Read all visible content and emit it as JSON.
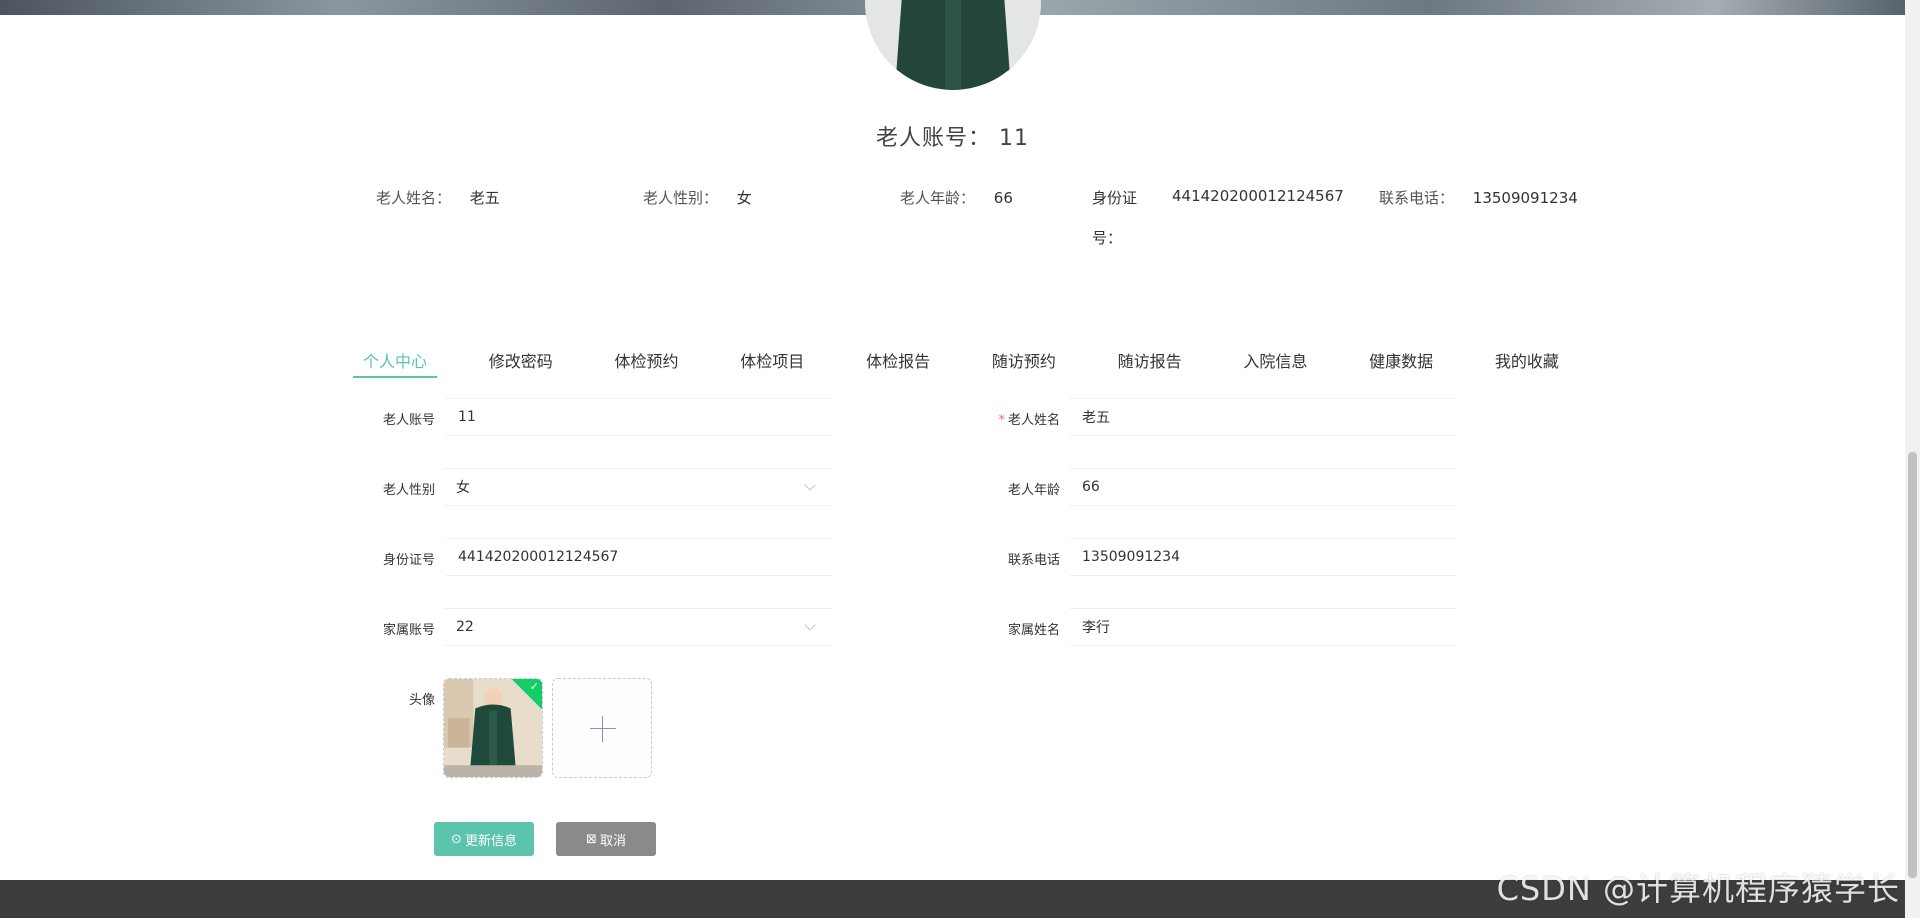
{
  "profile": {
    "account_label": "老人账号：",
    "account_value": "11",
    "info": [
      {
        "label": "老人姓名：",
        "value": "老五"
      },
      {
        "label": "老人性别：",
        "value": "女"
      },
      {
        "label": "老人年龄：",
        "value": "66"
      },
      {
        "label_line1": "身份证",
        "label_line2": "号：",
        "value": "441420200012124567"
      },
      {
        "label": "联系电话：",
        "value": "13509091234"
      }
    ]
  },
  "tabs": [
    {
      "label": "个人中心",
      "active": true
    },
    {
      "label": "修改密码"
    },
    {
      "label": "体检预约"
    },
    {
      "label": "体检项目"
    },
    {
      "label": "体检报告"
    },
    {
      "label": "随访预约"
    },
    {
      "label": "随访报告"
    },
    {
      "label": "入院信息"
    },
    {
      "label": "健康数据"
    },
    {
      "label": "我的收藏"
    }
  ],
  "form": {
    "account_label": "老人账号",
    "account_value": "11",
    "name_label": "老人姓名",
    "name_value": "老五",
    "name_required": "*",
    "gender_label": "老人性别",
    "gender_value": "女",
    "age_label": "老人年龄",
    "age_value": "66",
    "idcard_label": "身份证号",
    "idcard_value": "441420200012124567",
    "phone_label": "联系电话",
    "phone_value": "13509091234",
    "family_account_label": "家属账号",
    "family_account_value": "22",
    "family_name_label": "家属姓名",
    "family_name_value": "李行",
    "avatar_label": "头像"
  },
  "buttons": {
    "update_icon": "check-circle-icon",
    "update_label": "更新信息",
    "cancel_icon": "close-square-icon",
    "cancel_label": "取消"
  },
  "watermark": "CSDN @计算机程序猿学长",
  "colors": {
    "accent": "#5cc3ad",
    "cancel": "#8a8a8a",
    "footer": "#3d3d3d",
    "success": "#13ce66"
  }
}
